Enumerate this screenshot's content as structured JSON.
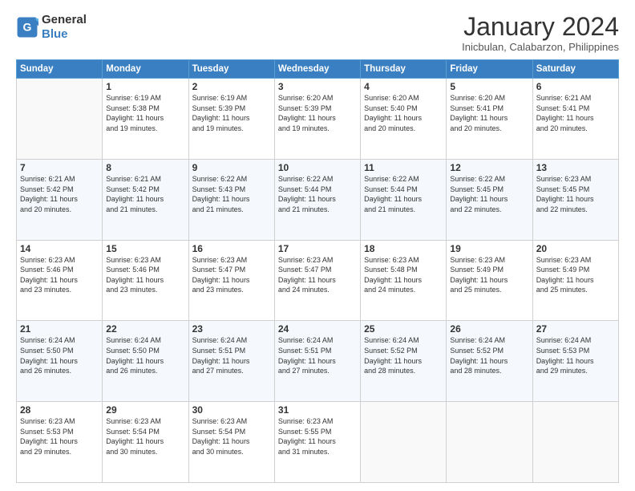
{
  "logo": {
    "line1": "General",
    "line2": "Blue"
  },
  "title": "January 2024",
  "subtitle": "Inicbulan, Calabarzon, Philippines",
  "days_header": [
    "Sunday",
    "Monday",
    "Tuesday",
    "Wednesday",
    "Thursday",
    "Friday",
    "Saturday"
  ],
  "weeks": [
    [
      {
        "day": "",
        "info": ""
      },
      {
        "day": "1",
        "info": "Sunrise: 6:19 AM\nSunset: 5:38 PM\nDaylight: 11 hours\nand 19 minutes."
      },
      {
        "day": "2",
        "info": "Sunrise: 6:19 AM\nSunset: 5:39 PM\nDaylight: 11 hours\nand 19 minutes."
      },
      {
        "day": "3",
        "info": "Sunrise: 6:20 AM\nSunset: 5:39 PM\nDaylight: 11 hours\nand 19 minutes."
      },
      {
        "day": "4",
        "info": "Sunrise: 6:20 AM\nSunset: 5:40 PM\nDaylight: 11 hours\nand 20 minutes."
      },
      {
        "day": "5",
        "info": "Sunrise: 6:20 AM\nSunset: 5:41 PM\nDaylight: 11 hours\nand 20 minutes."
      },
      {
        "day": "6",
        "info": "Sunrise: 6:21 AM\nSunset: 5:41 PM\nDaylight: 11 hours\nand 20 minutes."
      }
    ],
    [
      {
        "day": "7",
        "info": "Sunrise: 6:21 AM\nSunset: 5:42 PM\nDaylight: 11 hours\nand 20 minutes."
      },
      {
        "day": "8",
        "info": "Sunrise: 6:21 AM\nSunset: 5:42 PM\nDaylight: 11 hours\nand 21 minutes."
      },
      {
        "day": "9",
        "info": "Sunrise: 6:22 AM\nSunset: 5:43 PM\nDaylight: 11 hours\nand 21 minutes."
      },
      {
        "day": "10",
        "info": "Sunrise: 6:22 AM\nSunset: 5:44 PM\nDaylight: 11 hours\nand 21 minutes."
      },
      {
        "day": "11",
        "info": "Sunrise: 6:22 AM\nSunset: 5:44 PM\nDaylight: 11 hours\nand 21 minutes."
      },
      {
        "day": "12",
        "info": "Sunrise: 6:22 AM\nSunset: 5:45 PM\nDaylight: 11 hours\nand 22 minutes."
      },
      {
        "day": "13",
        "info": "Sunrise: 6:23 AM\nSunset: 5:45 PM\nDaylight: 11 hours\nand 22 minutes."
      }
    ],
    [
      {
        "day": "14",
        "info": "Sunrise: 6:23 AM\nSunset: 5:46 PM\nDaylight: 11 hours\nand 23 minutes."
      },
      {
        "day": "15",
        "info": "Sunrise: 6:23 AM\nSunset: 5:46 PM\nDaylight: 11 hours\nand 23 minutes."
      },
      {
        "day": "16",
        "info": "Sunrise: 6:23 AM\nSunset: 5:47 PM\nDaylight: 11 hours\nand 23 minutes."
      },
      {
        "day": "17",
        "info": "Sunrise: 6:23 AM\nSunset: 5:47 PM\nDaylight: 11 hours\nand 24 minutes."
      },
      {
        "day": "18",
        "info": "Sunrise: 6:23 AM\nSunset: 5:48 PM\nDaylight: 11 hours\nand 24 minutes."
      },
      {
        "day": "19",
        "info": "Sunrise: 6:23 AM\nSunset: 5:49 PM\nDaylight: 11 hours\nand 25 minutes."
      },
      {
        "day": "20",
        "info": "Sunrise: 6:23 AM\nSunset: 5:49 PM\nDaylight: 11 hours\nand 25 minutes."
      }
    ],
    [
      {
        "day": "21",
        "info": "Sunrise: 6:24 AM\nSunset: 5:50 PM\nDaylight: 11 hours\nand 26 minutes."
      },
      {
        "day": "22",
        "info": "Sunrise: 6:24 AM\nSunset: 5:50 PM\nDaylight: 11 hours\nand 26 minutes."
      },
      {
        "day": "23",
        "info": "Sunrise: 6:24 AM\nSunset: 5:51 PM\nDaylight: 11 hours\nand 27 minutes."
      },
      {
        "day": "24",
        "info": "Sunrise: 6:24 AM\nSunset: 5:51 PM\nDaylight: 11 hours\nand 27 minutes."
      },
      {
        "day": "25",
        "info": "Sunrise: 6:24 AM\nSunset: 5:52 PM\nDaylight: 11 hours\nand 28 minutes."
      },
      {
        "day": "26",
        "info": "Sunrise: 6:24 AM\nSunset: 5:52 PM\nDaylight: 11 hours\nand 28 minutes."
      },
      {
        "day": "27",
        "info": "Sunrise: 6:24 AM\nSunset: 5:53 PM\nDaylight: 11 hours\nand 29 minutes."
      }
    ],
    [
      {
        "day": "28",
        "info": "Sunrise: 6:23 AM\nSunset: 5:53 PM\nDaylight: 11 hours\nand 29 minutes."
      },
      {
        "day": "29",
        "info": "Sunrise: 6:23 AM\nSunset: 5:54 PM\nDaylight: 11 hours\nand 30 minutes."
      },
      {
        "day": "30",
        "info": "Sunrise: 6:23 AM\nSunset: 5:54 PM\nDaylight: 11 hours\nand 30 minutes."
      },
      {
        "day": "31",
        "info": "Sunrise: 6:23 AM\nSunset: 5:55 PM\nDaylight: 11 hours\nand 31 minutes."
      },
      {
        "day": "",
        "info": ""
      },
      {
        "day": "",
        "info": ""
      },
      {
        "day": "",
        "info": ""
      }
    ]
  ]
}
